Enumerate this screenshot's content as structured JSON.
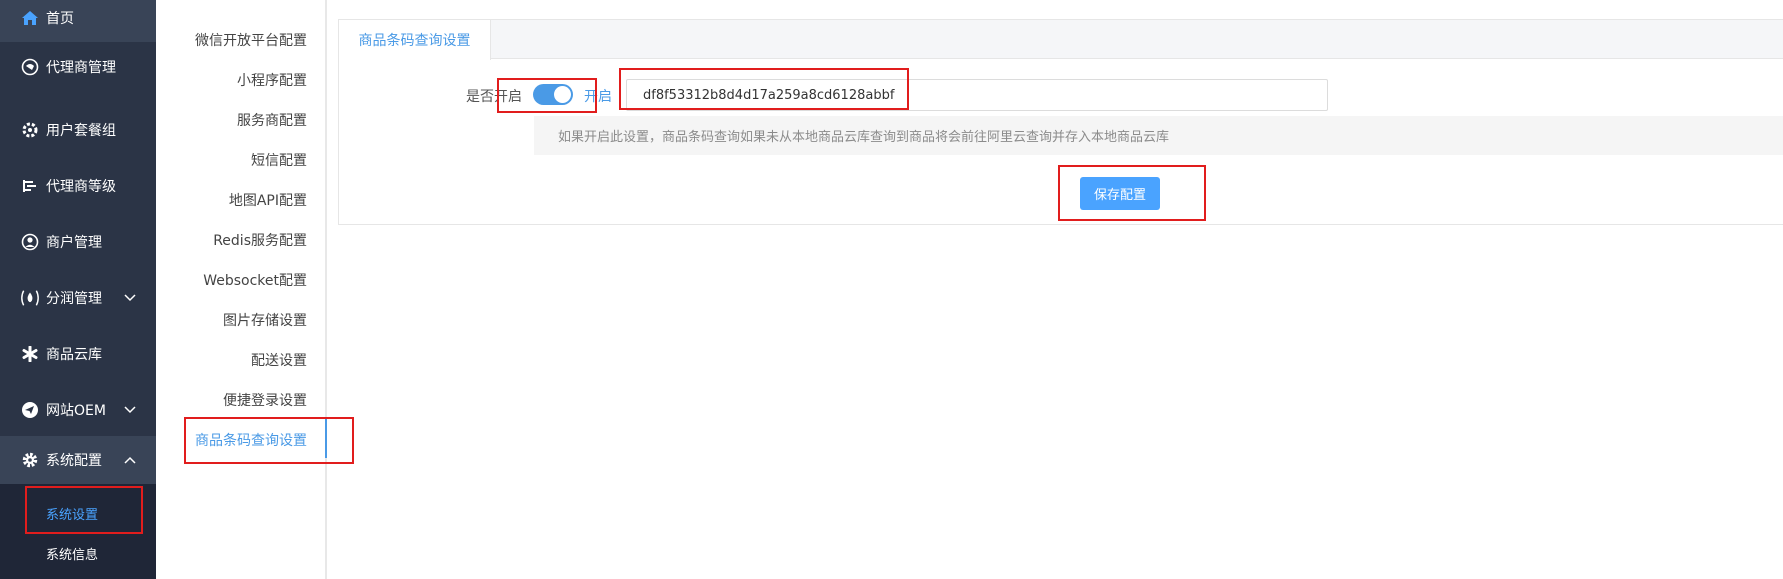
{
  "sidebar": {
    "items": [
      {
        "label": "首页",
        "icon": "home-icon"
      },
      {
        "label": "代理商管理",
        "icon": "agent-icon"
      },
      {
        "label": "用户套餐组",
        "icon": "package-icon"
      },
      {
        "label": "代理商等级",
        "icon": "level-icon"
      },
      {
        "label": "商户管理",
        "icon": "user-icon"
      },
      {
        "label": "分润管理",
        "icon": "profit-icon"
      },
      {
        "label": "商品云库",
        "icon": "asterisk-icon"
      },
      {
        "label": "网站OEM",
        "icon": "send-icon"
      },
      {
        "label": "系统配置",
        "icon": "gear-icon"
      }
    ],
    "submenu": [
      {
        "label": "系统设置",
        "active": true
      },
      {
        "label": "系统信息",
        "active": false
      }
    ]
  },
  "config_nav": {
    "items": [
      "微信开放平台配置",
      "小程序配置",
      "服务商配置",
      "短信配置",
      "地图API配置",
      "Redis服务配置",
      "Websocket配置",
      "图片存储设置",
      "配送设置",
      "便捷登录设置",
      "商品条码查询设置"
    ],
    "active_index": 10
  },
  "tab": {
    "label": "商品条码查询设置"
  },
  "form": {
    "enable_label": "是否开启",
    "toggle_state": "开启",
    "appcode_value": "df8f53312b8d4d17a259a8cd6128abbf",
    "hint": "如果开启此设置，商品条码查询如果未从本地商品云库查询到商品将会前往阿里云查询并存入本地商品云库",
    "save_label": "保存配置"
  },
  "colors": {
    "sidebar_bg": "#2b3446",
    "accent": "#4a9ae6",
    "button": "#4aa3ff",
    "highlight": "#e11d1d"
  }
}
